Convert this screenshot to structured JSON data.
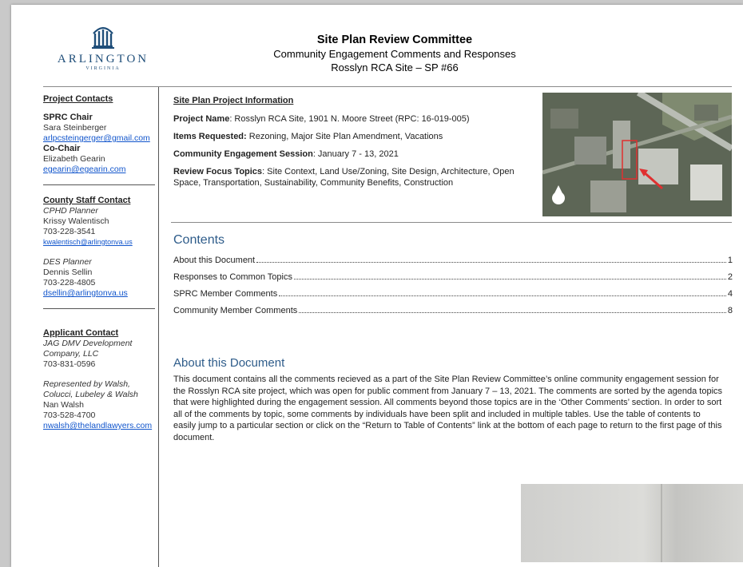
{
  "logo": {
    "name": "ARLINGTON",
    "sub": "VIRGINIA"
  },
  "header": {
    "title": "Site Plan Review Committee",
    "subtitle": "Community Engagement Comments and Responses",
    "site": "Rosslyn RCA Site – SP #66"
  },
  "sidebar": {
    "project_contacts": {
      "heading": "Project Contacts",
      "chair_label": "SPRC Chair",
      "chair_name": "Sara Steinberger",
      "chair_email": "arlpcsteingerger@gmail.com",
      "cochair_label": "Co-Chair",
      "cochair_name": "Elizabeth Gearin",
      "cochair_email": "egearin@egearin.com"
    },
    "county_staff": {
      "heading": "County Staff Contact",
      "cphd_role": "CPHD Planner",
      "cphd_name": "Krissy Walentisch",
      "cphd_phone": "703-228-3541",
      "cphd_email": "kwalentisch@arlingtonva.us",
      "des_role": "DES Planner",
      "des_name": "Dennis Sellin",
      "des_phone": "703-228-4805",
      "des_email": "dsellin@arlingtonva.us"
    },
    "applicant": {
      "heading": "Applicant Contact",
      "company": "JAG DMV Development Company, LLC",
      "phone": "703-831-0596",
      "rep": "Represented by Walsh, Colucci, Lubeley & Walsh",
      "rep_name": "Nan Walsh",
      "rep_phone": "703-528-4700",
      "rep_email": "nwalsh@thelandlawyers.com"
    }
  },
  "project_info": {
    "heading": "Site Plan Project Information",
    "name_label": "Project Name",
    "name_value": ": Rosslyn RCA Site, 1901 N. Moore Street (RPC: 16-019-005)",
    "items_label": "Items Requested:",
    "items_value": " Rezoning, Major Site Plan Amendment, Vacations",
    "session_label": "Community Engagement Session",
    "session_value": ": January 7 - 13, 2021",
    "topics_label": "Review Focus Topics",
    "topics_value": ": Site Context, Land Use/Zoning, Site Design, Architecture, Open Space, Transportation, Sustainability, Community Benefits, Construction"
  },
  "contents": {
    "title": "Contents",
    "items": [
      {
        "label": "About this Document",
        "page": "1"
      },
      {
        "label": "Responses to Common Topics",
        "page": "2"
      },
      {
        "label": "SPRC Member Comments",
        "page": "4"
      },
      {
        "label": "Community Member Comments",
        "page": "8"
      }
    ]
  },
  "about": {
    "title": "About this Document",
    "body": "This document contains all the comments recieved as a part of the Site Plan Review Committee’s online community engagement session for the Rosslyn RCA site project, which was open for public comment from January 7 – 13, 2021. The comments are sorted by the agenda topics that were highlighted during the engagement session. All comments beyond those topics are in the ‘Other Comments’ section. In order to sort all of the comments by topic, some comments by individuals have been split and included in multiple tables. Use the table of contents to easily jump to a particular section or click on the “Return to Table of Contents” link at the bottom of each page to return to the first page of this document."
  },
  "colors": {
    "heading_blue": "#2e5c8a",
    "link_blue": "#1155cc",
    "highlight_box": "#e03030"
  },
  "icons": {
    "logo": "arlington-building-icon",
    "photo": "aerial-site-photo"
  }
}
